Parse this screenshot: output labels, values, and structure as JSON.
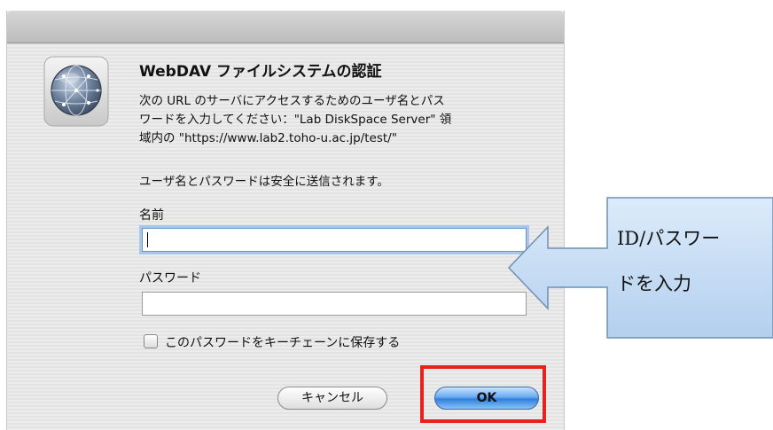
{
  "dialog": {
    "title": "WebDAV ファイルシステムの認証",
    "message_lines": [
      "次の URL のサーバにアクセスするためのユーザ名とパス",
      "ワードを入力してください：\"Lab DiskSpace Server\" 領",
      "域内の \"https://www.lab2.toho-u.ac.jp/test/\""
    ],
    "note": "ユーザ名とパスワードは安全に送信されます。",
    "name_label": "名前",
    "name_value": "",
    "password_label": "パスワード",
    "password_value": "",
    "keychain_label": "このパスワードをキーチェーンに保存する",
    "keychain_checked": false,
    "cancel_label": "キャンセル",
    "ok_label": "OK",
    "icon": "network-globe-icon"
  },
  "annotation": {
    "callout_lines": [
      "ID/パスワー",
      "ドを入力"
    ],
    "callout_color": "#c6dcf3",
    "highlight_color": "#e8211b"
  }
}
